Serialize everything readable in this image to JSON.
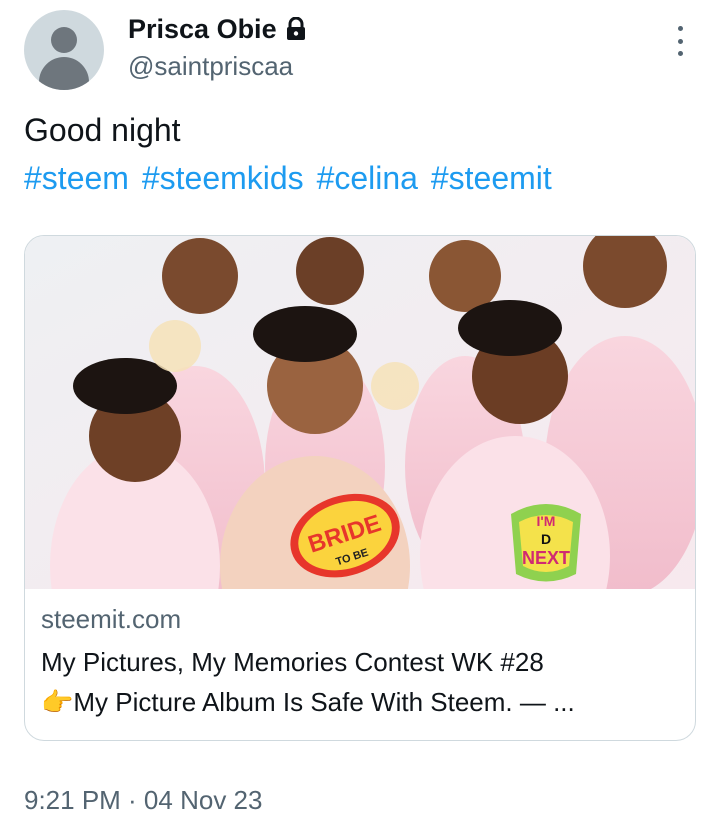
{
  "author": {
    "display_name": "Prisca Obie",
    "handle": "@saintpriscaa",
    "avatar_icon": "default-avatar-icon",
    "protected_icon": "lock-icon"
  },
  "tweet": {
    "text": "Good night",
    "hashtags": [
      "#steem",
      "#steemkids",
      "#celina",
      "#steemit"
    ],
    "timestamp": "9:21 PM · 04 Nov 23"
  },
  "card": {
    "domain": "steemit.com",
    "title_line1": "My Pictures, My Memories Contest WK #28",
    "title_line2_icon": "👉",
    "title_line2": "My Picture Album Is Safe With Steem. — ...",
    "image_signs": {
      "left": "BRIDE",
      "left_sub": "TO BE",
      "right_top": "I'M",
      "right_mid": "D",
      "right_bottom": "NEXT"
    }
  },
  "colors": {
    "link": "#1d9bf0",
    "secondary": "#536471",
    "primary_text": "#0f1419",
    "border": "#cfd9de"
  }
}
